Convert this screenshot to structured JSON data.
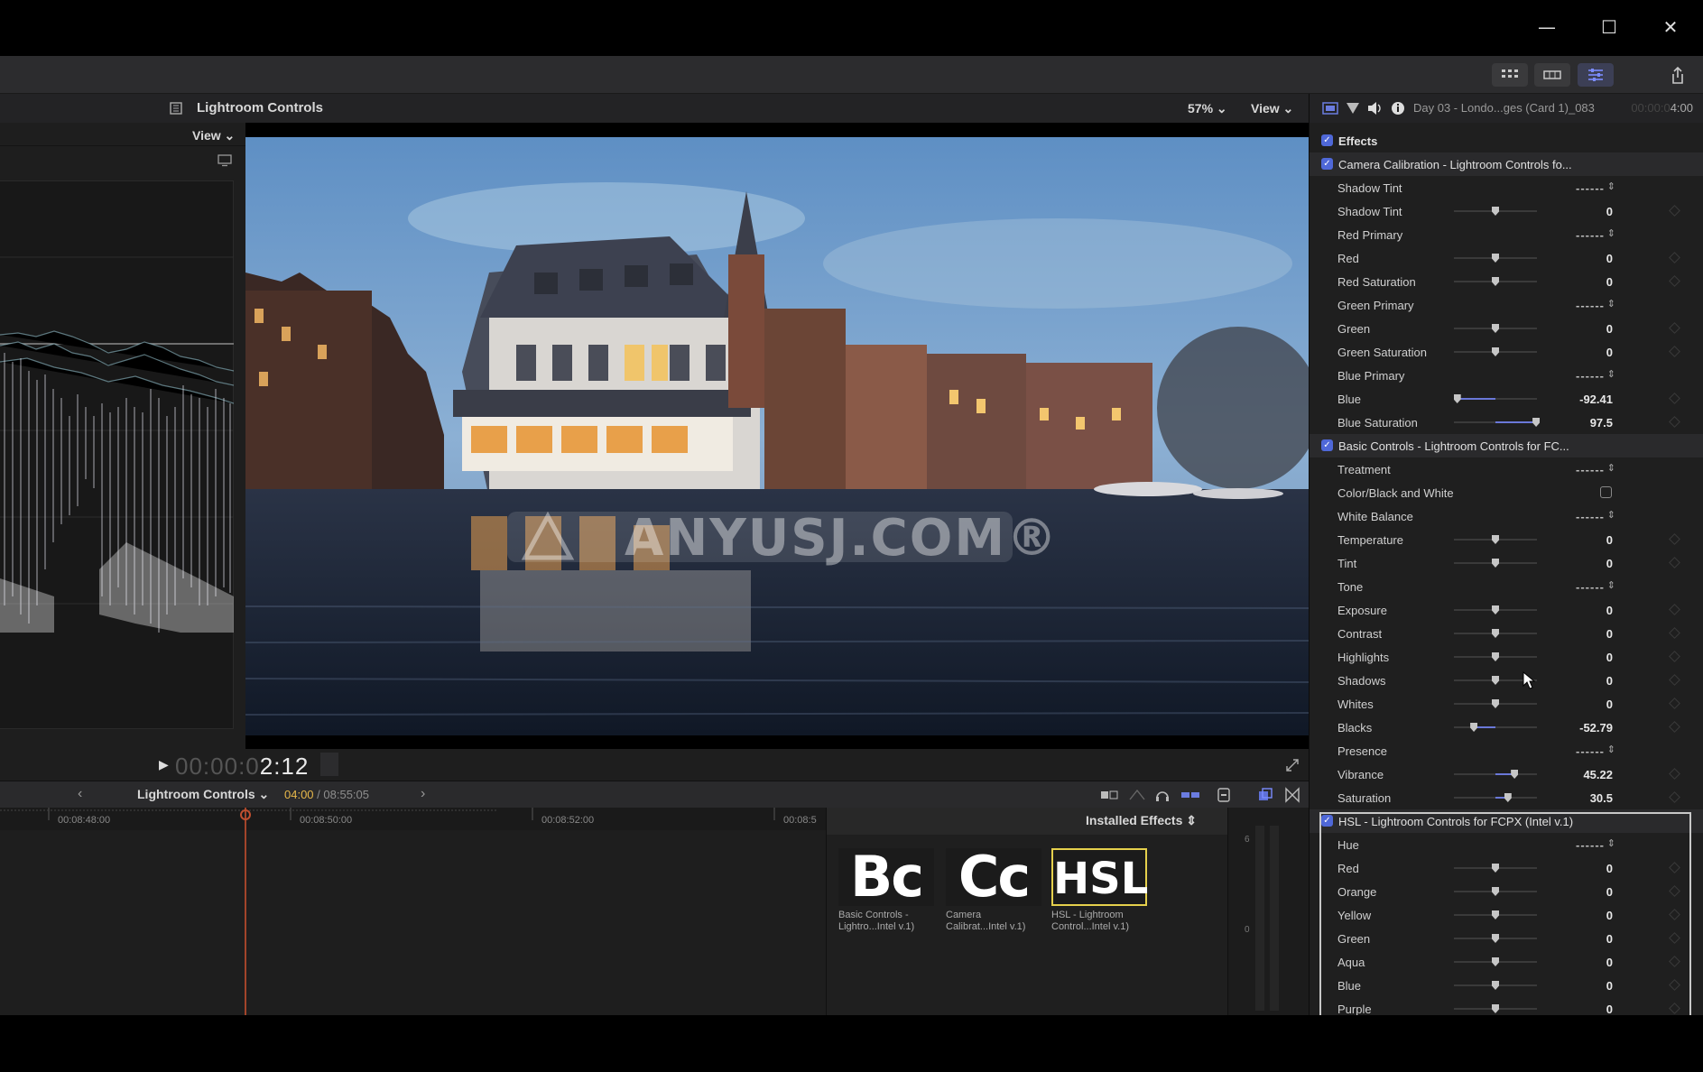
{
  "window": {
    "minimize": "—",
    "maximize": "☐",
    "close": "✕"
  },
  "toolbar": {
    "buttons": [
      "grid-view-icon",
      "filmstrip-icon",
      "inspector-icon",
      "share-icon"
    ]
  },
  "viewer": {
    "title": "Lightroom Controls",
    "zoom": "57% ⌄",
    "view": "View ⌄",
    "scope_view": "View ⌄",
    "timecode_dim": "00:00:0",
    "timecode_main": "2:12"
  },
  "watermark": "ANYUSJ.COM®",
  "timeline": {
    "project": "Lightroom Controls",
    "current": "04:00",
    "total": "08:55:05",
    "ruler": [
      "00:08:48:00",
      "00:08:50:00",
      "00:08:52:00",
      "00:08:5"
    ]
  },
  "browser": {
    "title": "Installed Effects",
    "effects": [
      {
        "thumb": "Bc",
        "caption_1": "Basic Controls -",
        "caption_2": "Lightro...Intel v.1)"
      },
      {
        "thumb": "Cc",
        "caption_1": "Camera",
        "caption_2": "Calibrat...Intel v.1)"
      },
      {
        "thumb": "HSL",
        "caption_1": "HSL - Lightroom",
        "caption_2": "Control...Intel v.1)"
      }
    ]
  },
  "inspector": {
    "clip_name": "Day 03 - Londo...ges (Card 1)_083",
    "tc_dim": "00:00:0",
    "tc": "4:00",
    "effects_label": "Effects",
    "sections": [
      {
        "title": "Camera Calibration - Lightroom Controls fo...",
        "rows": [
          {
            "label": "Shadow Tint",
            "kind": "popup",
            "value": "------"
          },
          {
            "label": "Shadow Tint",
            "kind": "slider",
            "value": "0",
            "pos": 0.5
          },
          {
            "label": "Red Primary",
            "kind": "popup",
            "value": "------"
          },
          {
            "label": "Red",
            "kind": "slider",
            "value": "0",
            "pos": 0.5
          },
          {
            "label": "Red Saturation",
            "kind": "slider",
            "value": "0",
            "pos": 0.5
          },
          {
            "label": "Green Primary",
            "kind": "popup",
            "value": "------"
          },
          {
            "label": "Green",
            "kind": "slider",
            "value": "0",
            "pos": 0.5
          },
          {
            "label": "Green Saturation",
            "kind": "slider",
            "value": "0",
            "pos": 0.5
          },
          {
            "label": "Blue Primary",
            "kind": "popup",
            "value": "------"
          },
          {
            "label": "Blue",
            "kind": "slider",
            "value": "-92.41",
            "pos": 0.04
          },
          {
            "label": "Blue Saturation",
            "kind": "slider",
            "value": "97.5",
            "pos": 0.99
          }
        ]
      },
      {
        "title": "Basic Controls - Lightroom Controls for FC...",
        "rows": [
          {
            "label": "Treatment",
            "kind": "popup",
            "value": "------"
          },
          {
            "label": "Color/Black and White",
            "kind": "checkbox",
            "value": ""
          },
          {
            "label": "White Balance",
            "kind": "popup",
            "value": "------"
          },
          {
            "label": "Temperature",
            "kind": "slider",
            "value": "0",
            "pos": 0.5
          },
          {
            "label": "Tint",
            "kind": "slider",
            "value": "0",
            "pos": 0.5
          },
          {
            "label": "Tone",
            "kind": "popup",
            "value": "------"
          },
          {
            "label": "Exposure",
            "kind": "slider",
            "value": "0",
            "pos": 0.5
          },
          {
            "label": "Contrast",
            "kind": "slider",
            "value": "0",
            "pos": 0.5
          },
          {
            "label": "Highlights",
            "kind": "slider",
            "value": "0",
            "pos": 0.5
          },
          {
            "label": "Shadows",
            "kind": "slider",
            "value": "0",
            "pos": 0.5
          },
          {
            "label": "Whites",
            "kind": "slider",
            "value": "0",
            "pos": 0.5
          },
          {
            "label": "Blacks",
            "kind": "slider",
            "value": "-52.79",
            "pos": 0.24
          },
          {
            "label": "Presence",
            "kind": "popup",
            "value": "------"
          },
          {
            "label": "Vibrance",
            "kind": "slider",
            "value": "45.22",
            "pos": 0.73
          },
          {
            "label": "Saturation",
            "kind": "slider",
            "value": "30.5",
            "pos": 0.65
          }
        ]
      },
      {
        "title": "HSL - Lightroom Controls for FCPX (Intel v.1)",
        "rows": [
          {
            "label": "Hue",
            "kind": "popup",
            "value": "------"
          },
          {
            "label": "Red",
            "kind": "slider",
            "value": "0",
            "pos": 0.5
          },
          {
            "label": "Orange",
            "kind": "slider",
            "value": "0",
            "pos": 0.5
          },
          {
            "label": "Yellow",
            "kind": "slider",
            "value": "0",
            "pos": 0.5
          },
          {
            "label": "Green",
            "kind": "slider",
            "value": "0",
            "pos": 0.5
          },
          {
            "label": "Aqua",
            "kind": "slider",
            "value": "0",
            "pos": 0.5
          },
          {
            "label": "Blue",
            "kind": "slider",
            "value": "0",
            "pos": 0.5
          },
          {
            "label": "Purple",
            "kind": "slider",
            "value": "0",
            "pos": 0.5
          }
        ]
      }
    ]
  }
}
